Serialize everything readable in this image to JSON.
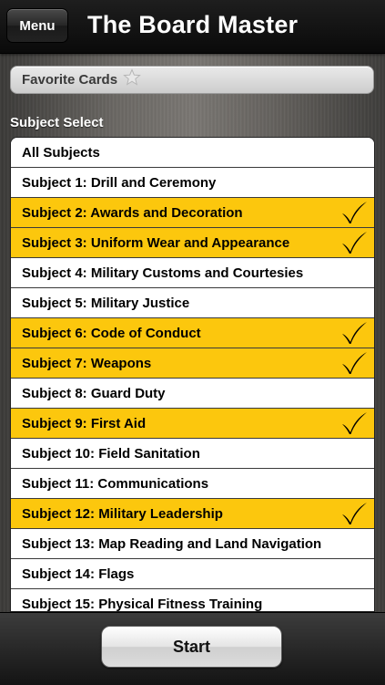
{
  "header": {
    "menu_label": "Menu",
    "title": "The Board Master"
  },
  "favorites": {
    "label": "Favorite Cards",
    "icon": "star-icon"
  },
  "subject_select": {
    "label": "Subject Select",
    "items": [
      {
        "label": "All Subjects",
        "selected": false
      },
      {
        "label": "Subject 1: Drill and Ceremony",
        "selected": false
      },
      {
        "label": "Subject 2: Awards and Decoration",
        "selected": true
      },
      {
        "label": "Subject 3: Uniform Wear and Appearance",
        "selected": true
      },
      {
        "label": "Subject 4: Military Customs and Courtesies",
        "selected": false
      },
      {
        "label": "Subject 5: Military Justice",
        "selected": false
      },
      {
        "label": "Subject 6: Code of Conduct",
        "selected": true
      },
      {
        "label": "Subject 7: Weapons",
        "selected": true
      },
      {
        "label": "Subject 8: Guard Duty",
        "selected": false
      },
      {
        "label": "Subject 9: First Aid",
        "selected": true
      },
      {
        "label": "Subject 10: Field Sanitation",
        "selected": false
      },
      {
        "label": "Subject 11: Communications",
        "selected": false
      },
      {
        "label": "Subject 12: Military Leadership",
        "selected": true
      },
      {
        "label": "Subject 13: Map Reading and Land Navigation",
        "selected": false
      },
      {
        "label": "Subject 14: Flags",
        "selected": false
      },
      {
        "label": "Subject 15: Physical Fitness Training",
        "selected": false
      }
    ]
  },
  "footer": {
    "start_label": "Start"
  },
  "colors": {
    "selected_row": "#fcc70d",
    "header_bg": "#111111"
  }
}
